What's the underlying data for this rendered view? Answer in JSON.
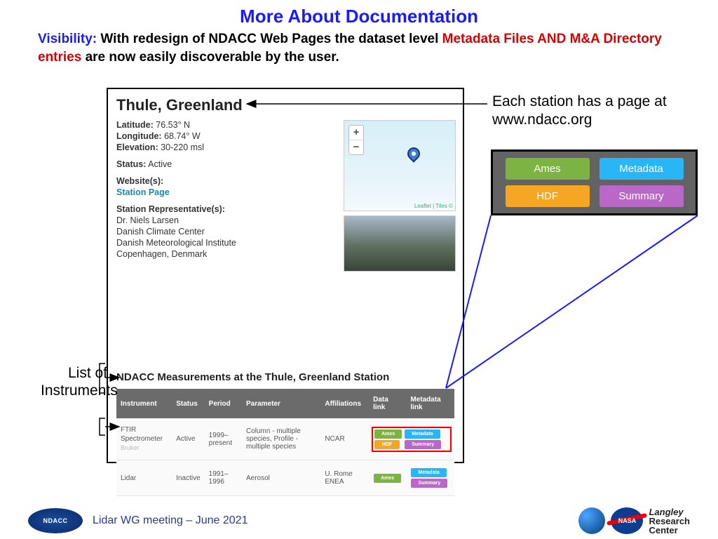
{
  "title": "More About Documentation",
  "subtitle": {
    "label": "Visibility:",
    "part1": "With redesign of NDACC Web Pages the dataset level",
    "highlight": "Metadata Files AND M&A Directory entries",
    "part2": "are now easily discoverable by the user."
  },
  "station": {
    "name": "Thule, Greenland",
    "lat_label": "Latitude:",
    "lat": "76.53° N",
    "lon_label": "Longitude:",
    "lon": "68.74° W",
    "elev_label": "Elevation:",
    "elev": "30-220 msl",
    "status_label": "Status:",
    "status": "Active",
    "web_label": "Website(s):",
    "web_link": "Station Page",
    "rep_label": "Station Representative(s):",
    "reps": [
      "Dr. Niels Larsen",
      "Danish Climate Center",
      "Danish Meteorological Institute",
      "Copenhagen, Denmark"
    ],
    "measure_hdr": "NDACC Measurements at the Thule, Greenland Station",
    "map_credit": "Leaflet | Tiles ©"
  },
  "table": {
    "headers": [
      "Instrument",
      "Status",
      "Period",
      "Parameter",
      "Affiliations",
      "Data link",
      "Metadata link"
    ],
    "rows": [
      {
        "instrument": "FTIR Spectrometer",
        "maker": "Bruker",
        "status": "Active",
        "period": "1999–present",
        "param": "Column - multiple species, Profile - multiple species",
        "affil": "NCAR",
        "data": [
          "Ames",
          "HDF"
        ],
        "meta": [
          "Metadata",
          "Summary"
        ],
        "boxed": true
      },
      {
        "instrument": "Lidar",
        "maker": "",
        "status": "Inactive",
        "period": "1991–1996",
        "param": "Aerosol",
        "affil": "U. Rome ENEA",
        "data": [
          "Ames"
        ],
        "meta": [
          "Metadata",
          "Summary"
        ],
        "boxed": false
      }
    ]
  },
  "annotations": {
    "station": "Each station has a page at www.ndacc.org",
    "instruments": "List of Instruments"
  },
  "zoom_pills": [
    "Ames",
    "Metadata",
    "HDF",
    "Summary"
  ],
  "footer": {
    "text": "Lidar WG meeting – June 2021",
    "ndacc": "NDACC",
    "nasa": "NASA",
    "langley1": "Langley",
    "langley2": "Research",
    "langley3": "Center"
  }
}
